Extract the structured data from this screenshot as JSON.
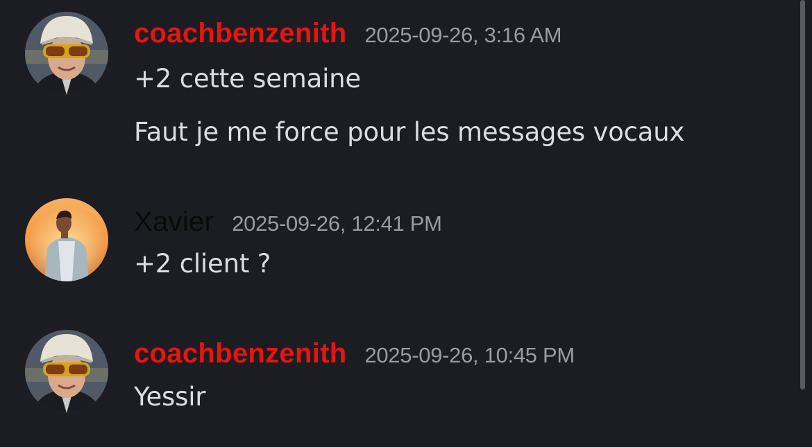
{
  "colors": {
    "background": "#1c1d22",
    "username_coach": "#e8140f",
    "username_xavier": "#0a0a0a",
    "timestamp": "#9a9ba3",
    "message_text": "#dcdde1"
  },
  "messages": [
    {
      "username": "coachbenzenith",
      "timestamp": "2025-09-26, 3:16 AM",
      "lines": [
        "+2 cette semaine",
        "Faut je me force pour les messages vocaux"
      ]
    },
    {
      "username": "Xavier",
      "timestamp": "2025-09-26, 12:41 PM",
      "lines": [
        "+2 client ?"
      ]
    },
    {
      "username": "coachbenzenith",
      "timestamp": "2025-09-26, 10:45 PM",
      "lines": [
        "Yessir"
      ]
    }
  ]
}
